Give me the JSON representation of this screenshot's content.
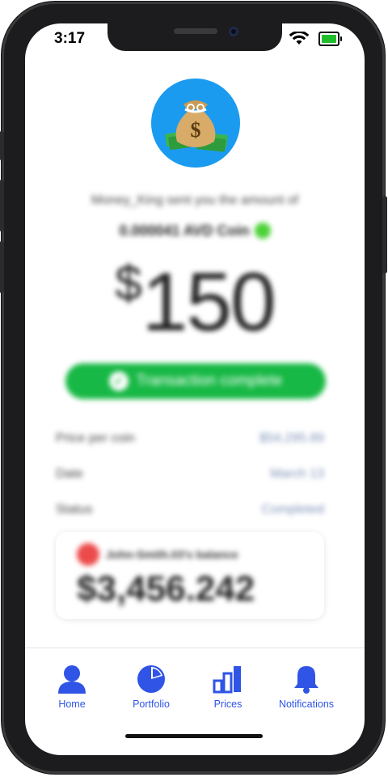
{
  "status_bar": {
    "time": "3:17"
  },
  "transaction": {
    "sender_line": "Money_King sent you the amount of",
    "coin_amount": "0.000041 AVD Coin",
    "currency_symbol": "$",
    "amount": "150",
    "status_pill": "Transaction complete"
  },
  "details": [
    {
      "label": "Price per coin",
      "value": "$54,295.89"
    },
    {
      "label": "Date",
      "value": "March 13"
    },
    {
      "label": "Status",
      "value": "Completed"
    }
  ],
  "balance_card": {
    "owner": "John-Smith.03's balance",
    "balance": "$3,456.242"
  },
  "tabs": [
    {
      "label": "Home",
      "icon": "person-icon"
    },
    {
      "label": "Portfolio",
      "icon": "pie-chart-icon"
    },
    {
      "label": "Prices",
      "icon": "bar-chart-icon"
    },
    {
      "label": "Notifications",
      "icon": "bell-icon"
    }
  ],
  "colors": {
    "accent_blue": "#2f54e6",
    "success_green": "#17b845",
    "avatar_bg": "#1a9bf0"
  }
}
